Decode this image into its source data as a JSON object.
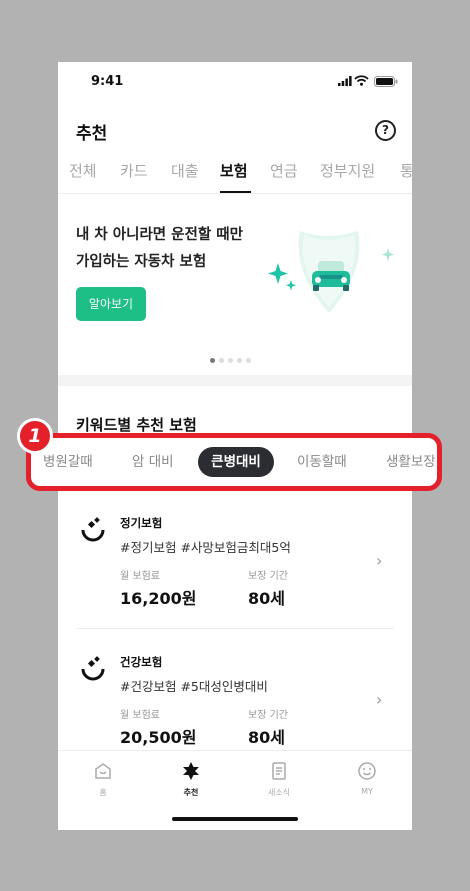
{
  "status": {
    "time": "9:41"
  },
  "header": {
    "title": "추천",
    "help_label": "?"
  },
  "tabs": [
    {
      "label": "전체"
    },
    {
      "label": "카드"
    },
    {
      "label": "대출"
    },
    {
      "label": "보험"
    },
    {
      "label": "연금"
    },
    {
      "label": "정부지원"
    },
    {
      "label": "통"
    }
  ],
  "banner": {
    "line1": "내 차 아니라면 운전할 때만",
    "line2": "가입하는 자동차 보험",
    "button": "알아보기"
  },
  "section": {
    "title": "키워드별 추천 보험"
  },
  "callout": {
    "badge": "1"
  },
  "chips": [
    {
      "label": "병원갈때"
    },
    {
      "label": "암 대비"
    },
    {
      "label": "큰병대비"
    },
    {
      "label": "이동할때"
    },
    {
      "label": "생활보장"
    }
  ],
  "cards": [
    {
      "name": "정기보험",
      "tags": "#정기보험 #사망보험금최대5억",
      "premium_label": "월 보험료",
      "premium": "16,200원",
      "period_label": "보장 기간",
      "period": "80세"
    },
    {
      "name": "건강보험",
      "tags": "#건강보험 #5대성인병대비",
      "premium_label": "월 보험료",
      "premium": "20,500원",
      "period_label": "보장 기간",
      "period": "80세"
    }
  ],
  "nav": [
    {
      "label": "홈"
    },
    {
      "label": "추천"
    },
    {
      "label": "새소식"
    },
    {
      "label": "MY"
    }
  ],
  "colors": {
    "accent": "#1dbf87",
    "highlight": "#e4202b",
    "chip_active": "#2b2d33"
  }
}
